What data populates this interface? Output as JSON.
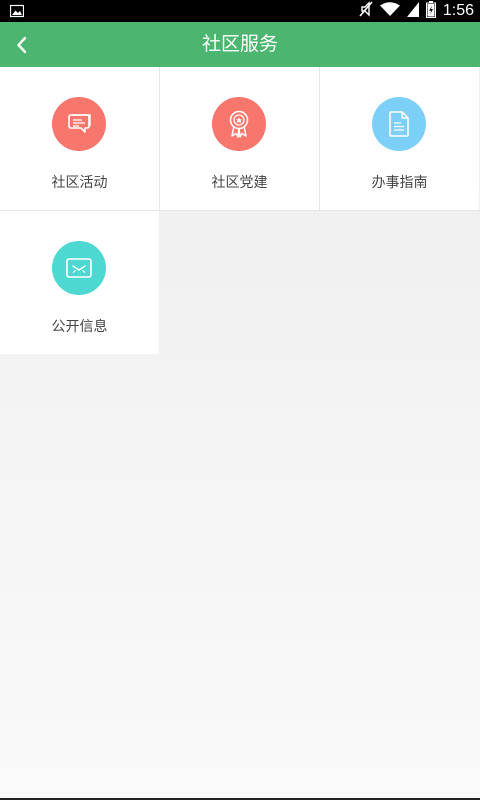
{
  "status_bar": {
    "time": "1:56",
    "icons": [
      "image-notification-icon",
      "muted-icon",
      "wifi-icon",
      "signal-icon",
      "battery-icon"
    ]
  },
  "app_bar": {
    "back_icon": "chevron-left-icon",
    "title": "社区服务",
    "background": "#4cb56f"
  },
  "services": [
    {
      "label": "社区活动",
      "icon": "chat-bubbles-icon",
      "color": "#f8766b"
    },
    {
      "label": "社区党建",
      "icon": "award-ribbon-icon",
      "color": "#f8766b"
    },
    {
      "label": "办事指南",
      "icon": "document-icon",
      "color": "#7ccff6"
    },
    {
      "label": "公开信息",
      "icon": "envelope-icon",
      "color": "#4dd9d2"
    }
  ]
}
